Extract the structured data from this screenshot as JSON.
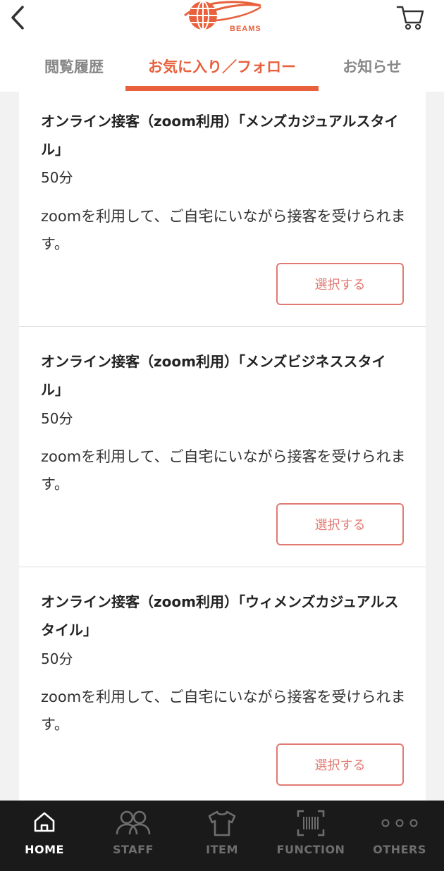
{
  "header": {
    "brand": "BEAMS",
    "accent_color": "#e8603c",
    "back_icon": "chevron-left-icon",
    "cart_icon": "cart-icon"
  },
  "tabs": [
    {
      "label": "閲覧履歴",
      "active": false
    },
    {
      "label": "お気に入り／フォロー",
      "active": true
    },
    {
      "label": "お知らせ",
      "active": false
    }
  ],
  "items": [
    {
      "title": "オンライン接客（zoom利用）「メンズカジュアルスタイル」",
      "duration": "50分",
      "description": "zoomを利用して、ご自宅にいながら接客を受けられます。",
      "button_label": "選択する"
    },
    {
      "title": "オンライン接客（zoom利用）「メンズビジネススタイル」",
      "duration": "50分",
      "description": "zoomを利用して、ご自宅にいながら接客を受けられます。",
      "button_label": "選択する"
    },
    {
      "title": "オンライン接客（zoom利用）「ウィメンズカジュアルスタイル」",
      "duration": "50分",
      "description": "zoomを利用して、ご自宅にいながら接客を受けられます。",
      "button_label": "選択する"
    }
  ],
  "bottom_nav": [
    {
      "label": "HOME",
      "icon": "home-icon",
      "active": true
    },
    {
      "label": "STAFF",
      "icon": "staff-icon",
      "active": false
    },
    {
      "label": "ITEM",
      "icon": "tshirt-icon",
      "active": false
    },
    {
      "label": "FUNCTION",
      "icon": "barcode-scan-icon",
      "active": false
    },
    {
      "label": "OTHERS",
      "icon": "more-dots-icon",
      "active": false
    }
  ]
}
